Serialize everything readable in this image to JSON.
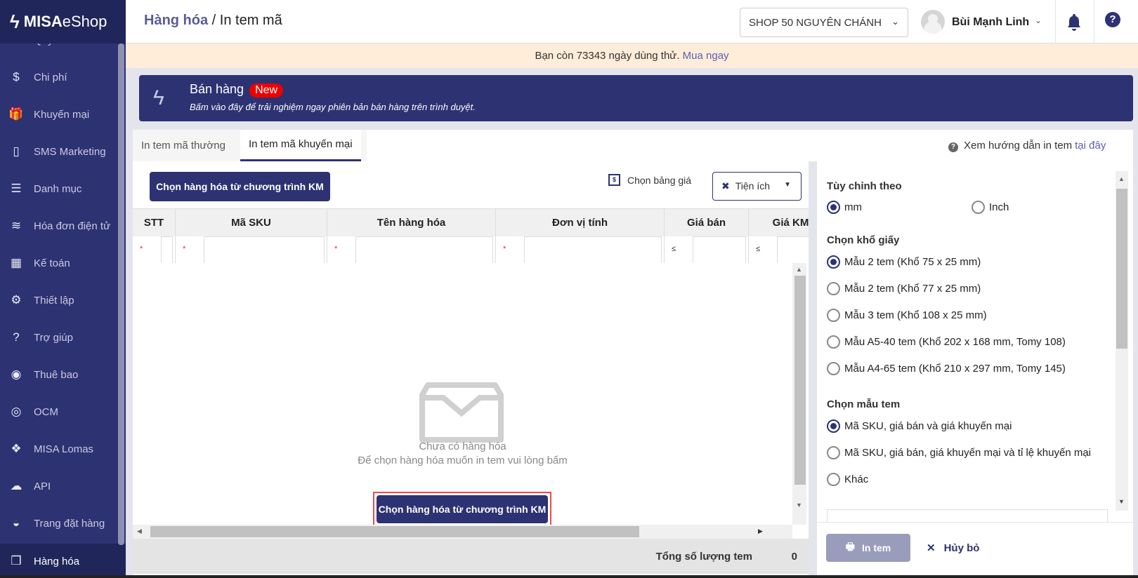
{
  "sidebar": {
    "logo": {
      "a": "MISA",
      "b": "eShop"
    },
    "items": [
      {
        "label": "Quỹ tiền",
        "icon": "cash-icon"
      },
      {
        "label": "Chi phí",
        "icon": "money-bag-icon"
      },
      {
        "label": "Khuyến mại",
        "icon": "gift-icon"
      },
      {
        "label": "SMS Marketing",
        "icon": "phone-icon"
      },
      {
        "label": "Danh mục",
        "icon": "list-icon"
      },
      {
        "label": "Hóa đơn điện tử",
        "icon": "invoice-icon"
      },
      {
        "label": "Kế toán",
        "icon": "calculator-icon"
      },
      {
        "label": "Thiết lập",
        "icon": "gear-icon"
      },
      {
        "label": "Trợ giúp",
        "icon": "help-icon"
      },
      {
        "label": "Thuê bao",
        "icon": "user-icon"
      },
      {
        "label": "OCM",
        "icon": "ocm-icon"
      },
      {
        "label": "MISA Lomas",
        "icon": "layers-icon"
      },
      {
        "label": "API",
        "icon": "cloud-upload-icon"
      },
      {
        "label": "Trang đặt hàng",
        "icon": "basket-icon"
      }
    ],
    "active": {
      "label": "Hàng hóa",
      "icon": "boxes-icon"
    }
  },
  "header": {
    "crumb": "Hàng hóa",
    "sep": " / ",
    "page": "In tem mã",
    "shop": "SHOP 50 NGUYÊN CHÁNH",
    "user": "Bùi Mạnh Linh"
  },
  "trial": {
    "text": "Bạn còn 73343 ngày dùng thử. ",
    "link": "Mua ngay"
  },
  "promo": {
    "title": "Bán hàng",
    "badge": "New",
    "subtitle": "Bấm vào đây để trải nghiệm ngay phiên bản bán hàng trên trình duyệt."
  },
  "tabs": [
    {
      "label": "In tem mã thường"
    },
    {
      "label": "In tem mã khuyến mại"
    }
  ],
  "guide": {
    "text": "Xem hướng dẫn in tem",
    "link": "tại đây"
  },
  "toolbar": {
    "pick": "Chọn hàng hóa từ chương trình KM",
    "price": "Chọn bảng giá",
    "util": "Tiện ích"
  },
  "table": {
    "columns": [
      "STT",
      "Mã SKU",
      "Tên hàng hóa",
      "Đơn vị tính",
      "Giá bán",
      "Giá KM"
    ],
    "filters": [
      "*",
      "*",
      "*",
      "*",
      "≤",
      "≤"
    ]
  },
  "empty": {
    "line1": "Chưa có hàng hóa",
    "line2": "Để chọn hàng hóa muốn in tem vui lòng bấm",
    "button": "Chọn hàng hóa từ chương trình KM"
  },
  "footer": {
    "total_label": "Tổng số lượng tem",
    "total": "0"
  },
  "settings": {
    "unit_title": "Tùy chỉnh theo",
    "units": [
      "mm",
      "Inch"
    ],
    "paper_title": "Chọn khổ giấy",
    "papers": [
      "Mẫu 2 tem (Khổ 75 x 25 mm)",
      "Mẫu 2 tem (Khổ 77 x 25 mm)",
      "Mẫu 3 tem (Khổ 108 x 25 mm)",
      "Mẫu A5-40 tem (Khổ 202 x 168 mm, Tomy 108)",
      "Mẫu A4-65 tem (Khổ 210 x 297 mm, Tomy 145)"
    ],
    "template_title": "Chọn mẫu tem",
    "templates": [
      "Mã SKU, giá bán và giá khuyến mại",
      "Mã SKU, giá bán, giá khuyến mại và tỉ lệ khuyến mại",
      "Khác"
    ]
  },
  "actions": {
    "print": "In tem",
    "cancel": "Hủy bỏ"
  },
  "colors": {
    "primary": "#2d3272",
    "badge": "#e00000",
    "trial_bg": "#ffecd9"
  }
}
